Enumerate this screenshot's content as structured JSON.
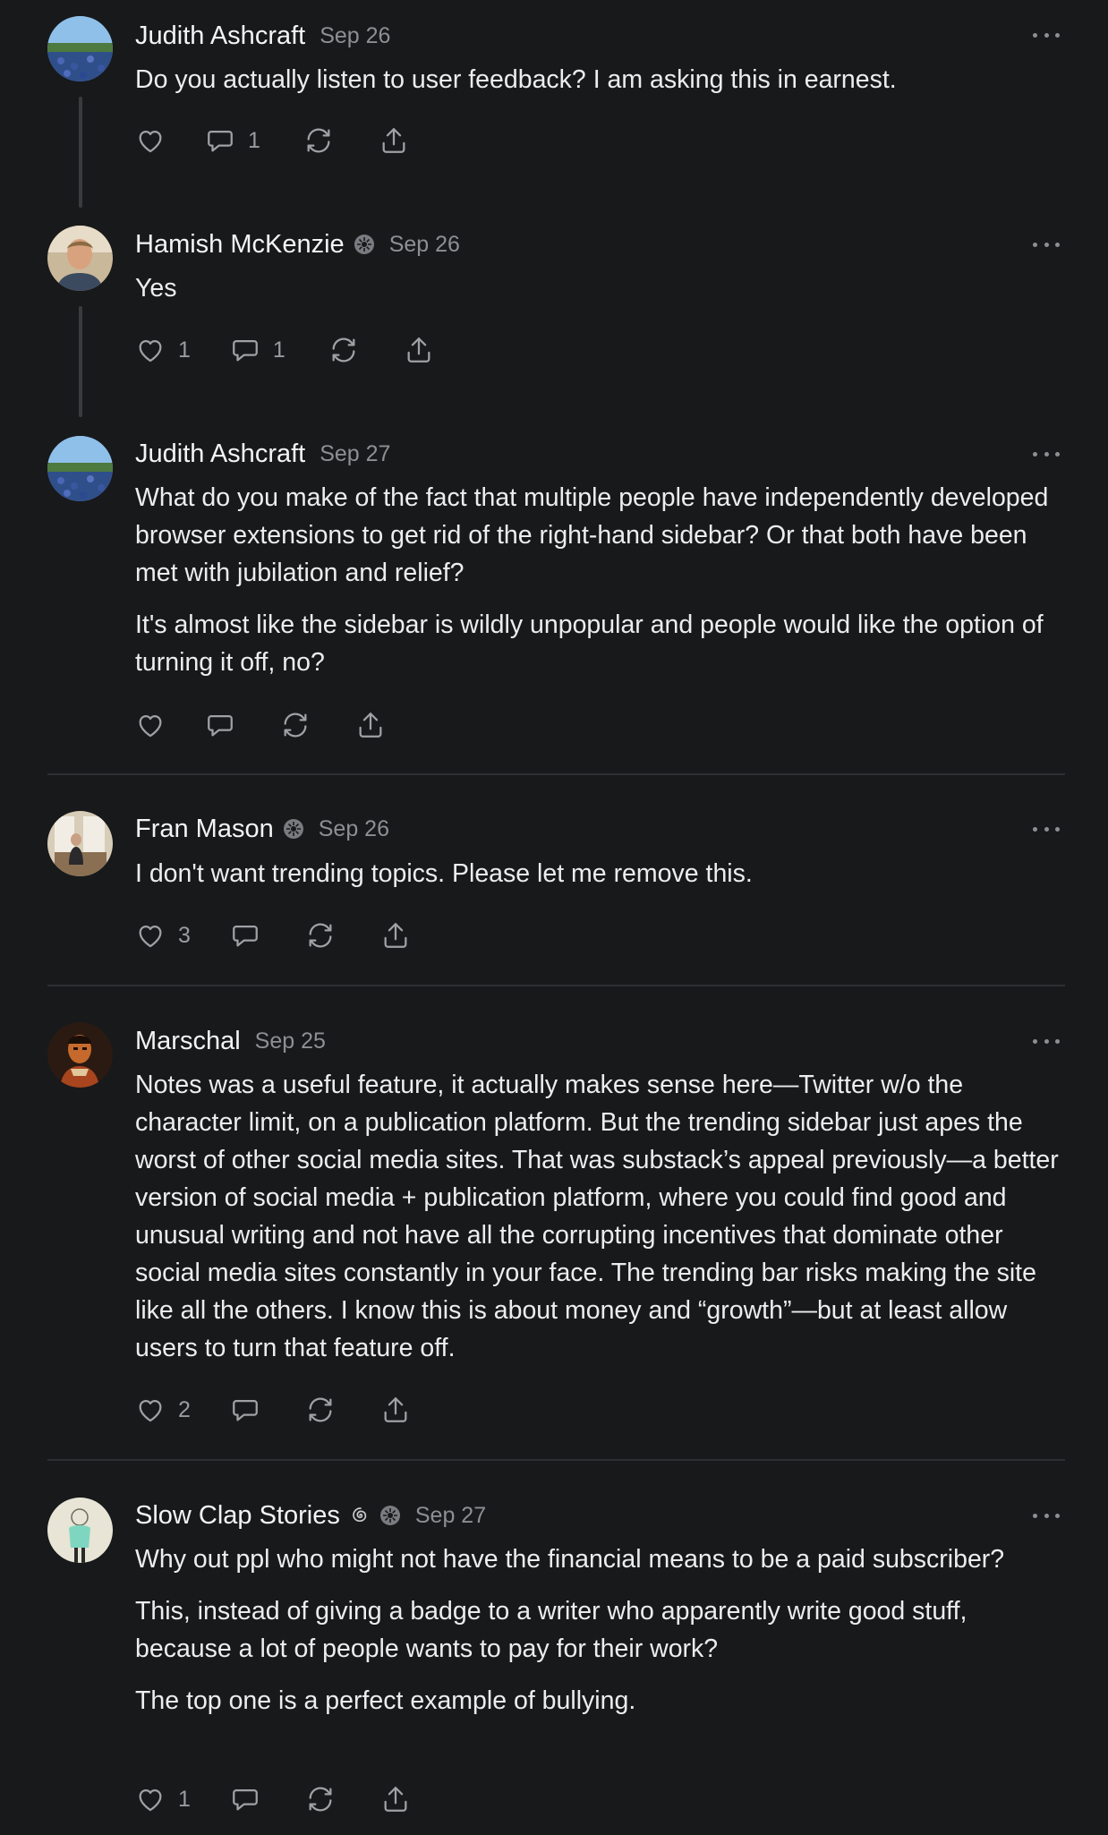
{
  "notes": [
    {
      "author": "Judith Ashcraft",
      "date": "Sep 26",
      "avatar": "bluebonnet-field-avatar",
      "paragraphs": [
        "Do you actually listen to user feedback? I am asking this in earnest."
      ],
      "likes": "",
      "comments": "1"
    },
    {
      "author": "Hamish McKenzie",
      "date": "Sep 26",
      "avatar": "man-portrait-avatar",
      "badges": [
        "flower-badge-icon"
      ],
      "paragraphs": [
        "Yes"
      ],
      "likes": "1",
      "comments": "1"
    },
    {
      "author": "Judith Ashcraft",
      "date": "Sep 27",
      "avatar": "bluebonnet-field-avatar",
      "paragraphs": [
        "What do you make of the fact that multiple people have independently developed browser extensions to get rid of the right-hand sidebar? Or that both have been met with jubilation and relief?",
        "It's almost like the sidebar is wildly unpopular and people would like the option of turning it off, no?"
      ],
      "likes": "",
      "comments": ""
    },
    {
      "author": "Fran Mason",
      "date": "Sep 26",
      "avatar": "person-at-window-avatar",
      "badges": [
        "flower-badge-icon"
      ],
      "paragraphs": [
        "I don't want trending topics. Please let me remove this."
      ],
      "likes": "3",
      "comments": ""
    },
    {
      "author": "Marschal",
      "date": "Sep 25",
      "avatar": "painted-figure-avatar",
      "paragraphs": [
        "Notes was a useful feature, it actually makes sense here—Twitter w/o the character limit, on a publication platform. But the trending sidebar just apes the worst of other social media sites. That was substack’s appeal previously—a better version of social media + publication platform, where you could find good and unusual writing and not have all the corrupting incentives that dominate other social media sites constantly in your face. The trending bar risks making the site like all the others. I know this is about money and “growth”—but at least allow users to turn that feature off."
      ],
      "likes": "2",
      "comments": ""
    },
    {
      "author": "Slow Clap Stories",
      "date": "Sep 27",
      "avatar": "sketch-figure-avatar",
      "badges": [
        "spiral-badge-icon",
        "flower-badge-icon"
      ],
      "paragraphs": [
        "Why out ppl who might not have the financial means to be a paid subscriber?",
        "This, instead of giving a badge to a writer who apparently write good stuff, because a lot of people wants to pay for their work?",
        "The top one is a perfect example of bullying."
      ],
      "likes": "1",
      "comments": ""
    }
  ]
}
